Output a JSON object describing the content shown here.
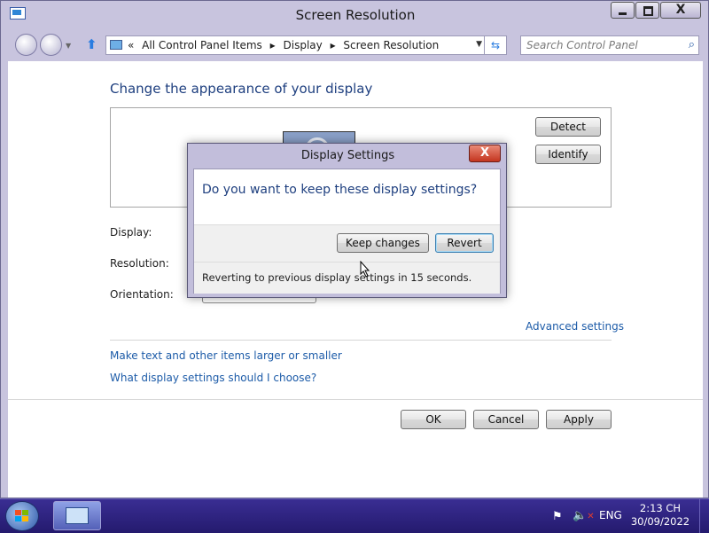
{
  "window": {
    "title": "Screen Resolution",
    "controls": {
      "minimize": "minimize",
      "maximize": "maximize",
      "close": "X"
    }
  },
  "address_bar": {
    "overflow": "«",
    "breadcrumbs": [
      "All Control Panel Items",
      "Display",
      "Screen Resolution"
    ],
    "separator": "▸"
  },
  "search": {
    "placeholder": "Search Control Panel"
  },
  "main": {
    "heading": "Change the appearance of your display",
    "detect_button": "Detect",
    "identify_button": "Identify",
    "labels": {
      "display": "Display:",
      "resolution": "Resolution:",
      "orientation": "Orientation:"
    },
    "advanced_link": "Advanced settings",
    "link_text_size": "Make text and other items larger or smaller",
    "link_help": "What display settings should I choose?",
    "ok_button": "OK",
    "cancel_button": "Cancel",
    "apply_button": "Apply"
  },
  "dialog": {
    "title": "Display Settings",
    "close": "X",
    "question": "Do you want to keep these display settings?",
    "keep_button": "Keep changes",
    "revert_button": "Revert",
    "status": "Reverting to previous display settings in 15 seconds."
  },
  "taskbar": {
    "language": "ENG",
    "time": "2:13 CH",
    "date": "30/09/2022",
    "icons": [
      "start-orb",
      "control-panel-app",
      "action-center-flag",
      "speaker-muted"
    ]
  },
  "colors": {
    "accent_link": "#1c5ba8",
    "heading": "#1e3f7f",
    "taskbar": "#2b2080"
  }
}
